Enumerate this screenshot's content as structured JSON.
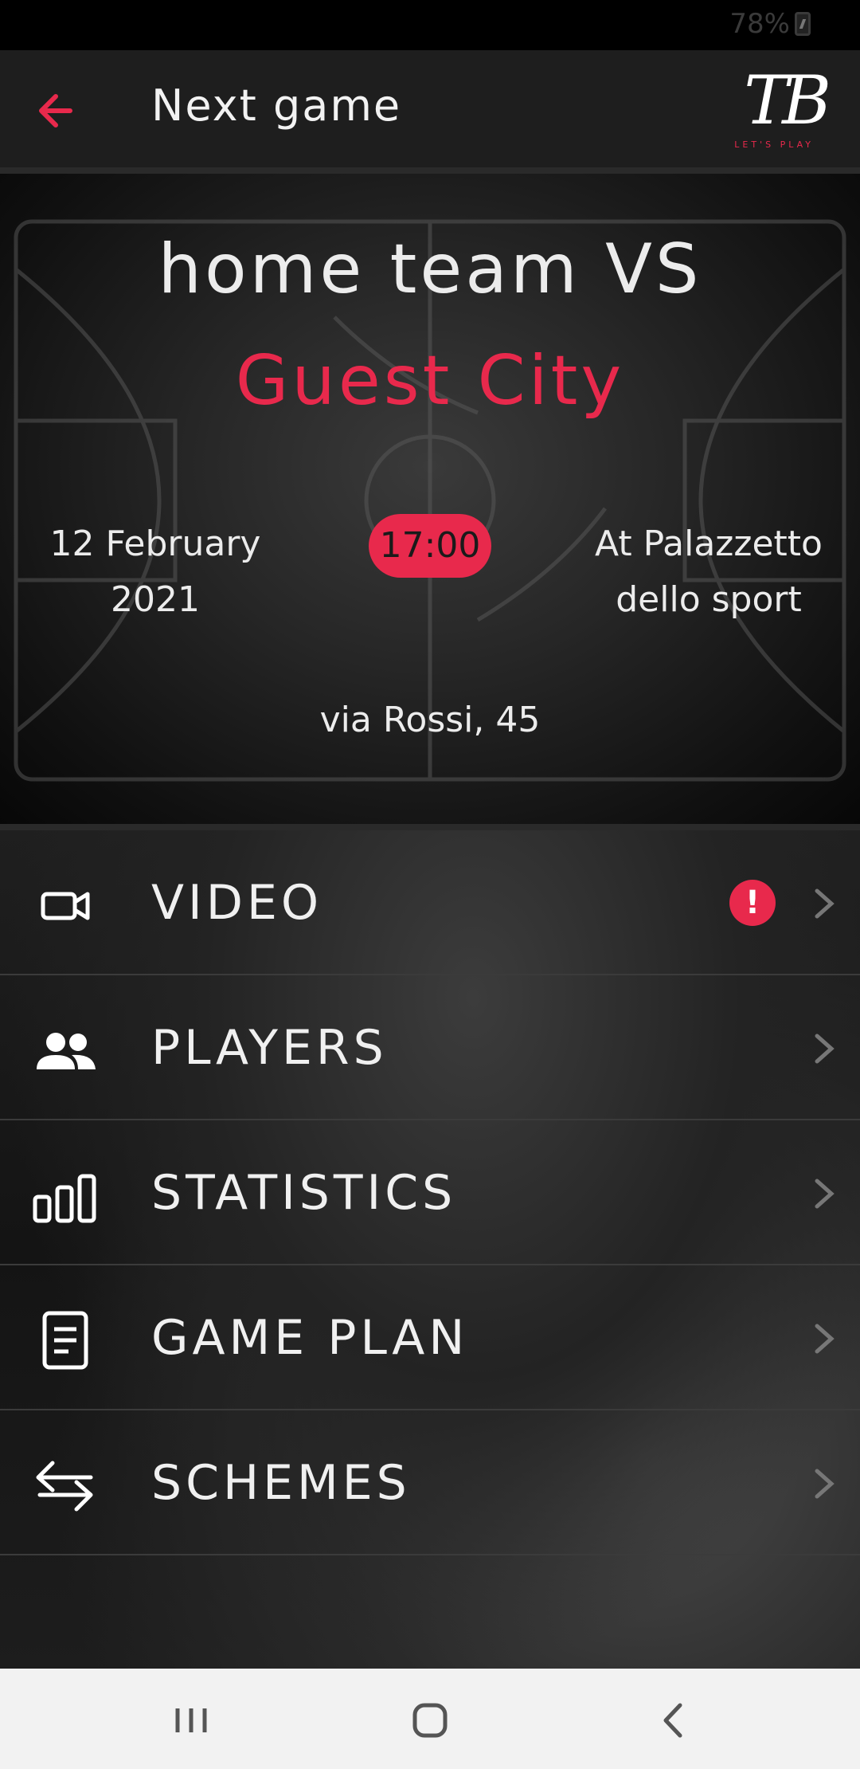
{
  "status_bar": {
    "battery": "78%"
  },
  "app_bar": {
    "title": "Next game",
    "logo_text": "TB",
    "logo_tagline": "LET'S PLAY"
  },
  "hero": {
    "line1": "home team VS",
    "line2": "Guest City",
    "date_line1": "12 February",
    "date_line2": "2021",
    "time": "17:00",
    "place_line1": "At Palazzetto",
    "place_line2": "dello sport",
    "address": "via Rossi, 45"
  },
  "menu": {
    "items": [
      {
        "label": "VIDEO",
        "icon": "video-icon",
        "alert": "!"
      },
      {
        "label": "PLAYERS",
        "icon": "people-icon"
      },
      {
        "label": "STATISTICS",
        "icon": "bar-chart-icon"
      },
      {
        "label": "GAME PLAN",
        "icon": "document-icon"
      },
      {
        "label": "SCHEMES",
        "icon": "swap-arrows-icon"
      }
    ]
  },
  "colors": {
    "accent": "#e8294c",
    "app_bar": "#1e1e1e",
    "nav_bar": "#f2f2f2"
  }
}
